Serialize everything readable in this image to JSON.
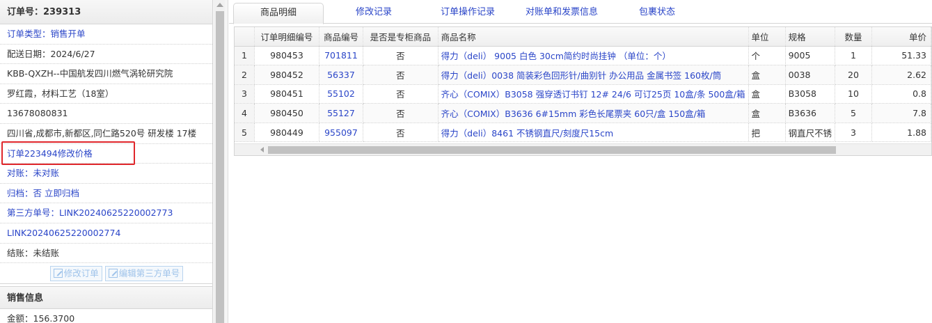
{
  "order": {
    "title": "订单号：239313",
    "type_label": "订单类型：",
    "type_value": "销售开单",
    "delivery_date": "配送日期：2024/6/27",
    "customer": "KBB-QXZH--中国航发四川燃气涡轮研究院",
    "contact": "罗红霞，材料工艺（18室）",
    "phone": "13678080831",
    "address": "四川省,成都市,新都区,同仁路520号 研发楼 17楼",
    "price_change_link": "订单223494修改价格",
    "reconcile_label": "对账：",
    "reconcile_value": "未对账",
    "archive_label": "归档：",
    "archive_value": "否",
    "archive_link": "立即归档",
    "third_party_label": "第三方单号：",
    "third_party_no_1": "LINK20240625220002773",
    "third_party_no_2": "LINK20240625220002774",
    "settle_label": "结账：",
    "settle_value": "未结账"
  },
  "buttons": {
    "edit_order": "修改订单",
    "edit_third_party": "编辑第三方单号"
  },
  "sales": {
    "title": "销售信息",
    "amount": "金额：156.3700"
  },
  "tabs": [
    "商品明细",
    "修改记录",
    "订单操作记录",
    "对账单和发票信息",
    "包裹状态"
  ],
  "table": {
    "headers": [
      "",
      "订单明细编号",
      "商品编号",
      "是否是专柜商品",
      "商品名称",
      "单位",
      "规格",
      "数量",
      "单价"
    ],
    "rows": [
      [
        "1",
        "980453",
        "701811",
        "否",
        "得力（deli） 9005 白色 30cm简约时尚挂钟 （单位：个）",
        "个",
        "9005",
        "1",
        "51.33"
      ],
      [
        "2",
        "980452",
        "56337",
        "否",
        "得力（deli）0038 简装彩色回形针/曲别针 办公用品 金属书签 160枚/筒",
        "盒",
        "0038",
        "20",
        "2.62"
      ],
      [
        "3",
        "980451",
        "55102",
        "否",
        "齐心（COMIX）B3058 强穿透订书钉 12# 24/6 可订25页 10盒/条 500盒/箱",
        "盒",
        "B3058",
        "10",
        "0.8"
      ],
      [
        "4",
        "980450",
        "55127",
        "否",
        "齐心（COMIX）B3636 6#15mm 彩色长尾票夹 60只/盒 150盒/箱",
        "盒",
        "B3636",
        "5",
        "7.8"
      ],
      [
        "5",
        "980449",
        "955097",
        "否",
        "得力（deli）8461 不锈钢直尺/刻度尺15cm",
        "把",
        "钢直尺不锈",
        "3",
        "1.88"
      ]
    ]
  },
  "colors": {
    "link": "#2a45c8",
    "highlight": "#e0262b"
  }
}
